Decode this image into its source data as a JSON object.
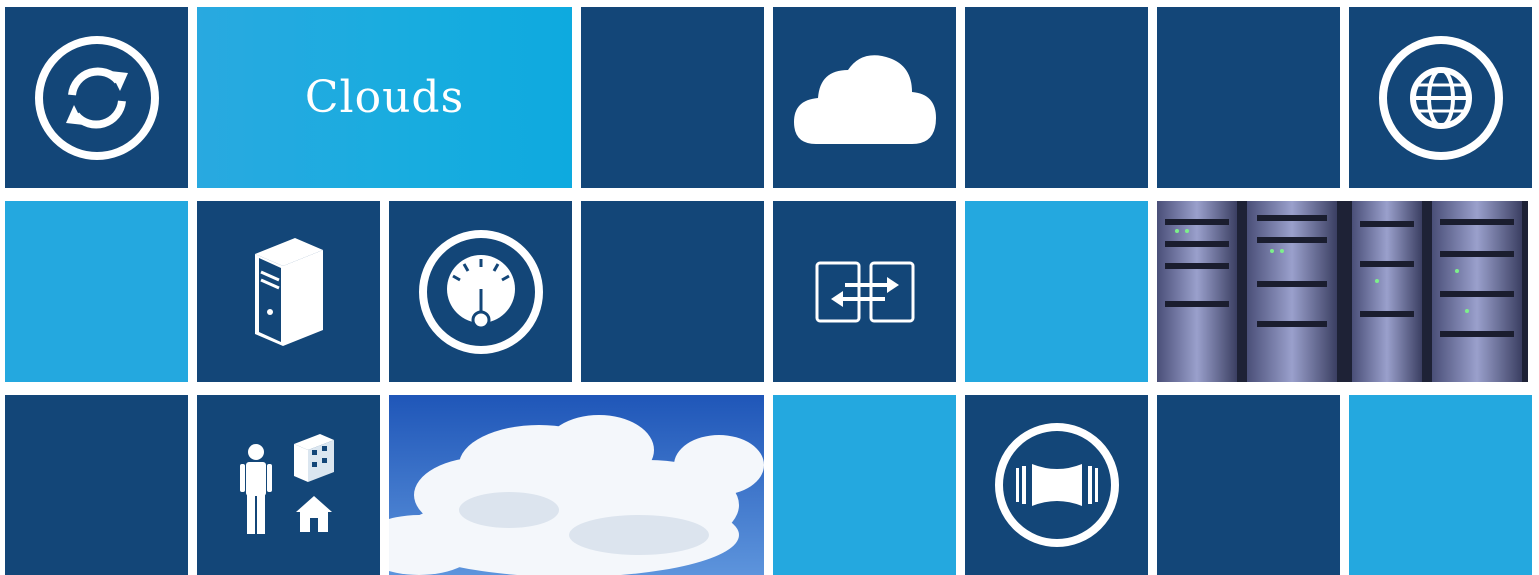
{
  "title_tile": {
    "text": "Clouds"
  },
  "colors": {
    "dark_tile": "#134678",
    "light_tile": "#24a8df",
    "background": "#ffffff",
    "icon": "#ffffff"
  },
  "icons": [
    "sync-icon",
    "cloud-icon",
    "globe-icon",
    "server-icon",
    "gauge-icon",
    "switch-icon",
    "people-buildings-icon",
    "panorama-icon"
  ],
  "images": [
    "server-rack-photo",
    "sky-clouds-photo"
  ]
}
